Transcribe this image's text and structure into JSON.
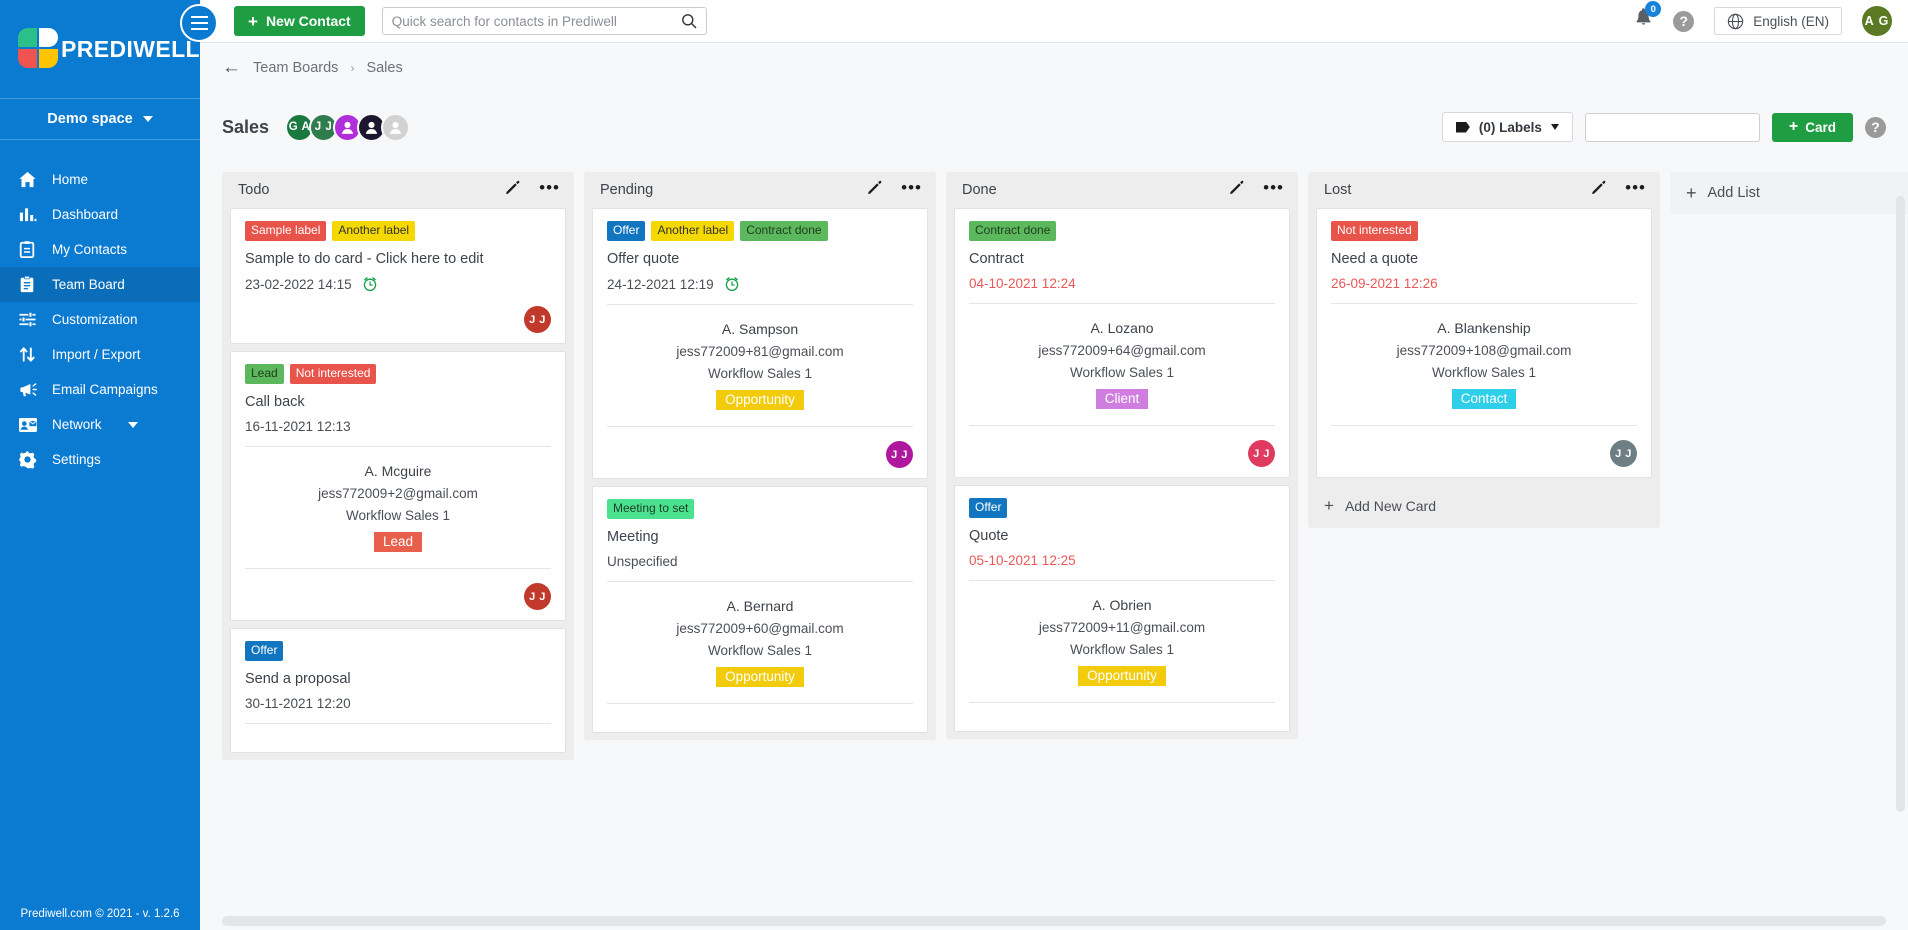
{
  "brand": {
    "name": "PREDIWELL",
    "space": "Demo space"
  },
  "topbar": {
    "new_contact_label": "New Contact",
    "search_placeholder": "Quick search for contacts in Prediwell",
    "search_value": "",
    "notifications_count": "0",
    "language": "English (EN)",
    "user_initials": "A G",
    "help_label": "?"
  },
  "sidebar": {
    "items": [
      {
        "label": "Home",
        "icon": "home-icon",
        "active": false
      },
      {
        "label": "Dashboard",
        "icon": "chart-icon",
        "active": false
      },
      {
        "label": "My Contacts",
        "icon": "contacts-icon",
        "active": false
      },
      {
        "label": "Team Board",
        "icon": "board-icon",
        "active": true
      },
      {
        "label": "Customization",
        "icon": "sliders-icon",
        "active": false
      },
      {
        "label": "Import / Export",
        "icon": "arrows-icon",
        "active": false
      },
      {
        "label": "Email Campaigns",
        "icon": "megaphone-icon",
        "active": false
      },
      {
        "label": "Network",
        "icon": "network-icon",
        "active": false,
        "caret": true
      },
      {
        "label": "Settings",
        "icon": "gear-icon",
        "active": false
      }
    ],
    "footer": "Prediwell.com © 2021 - v. 1.2.6"
  },
  "breadcrumb": {
    "back": "←",
    "parent": "Team Boards",
    "sep": "›",
    "current": "Sales"
  },
  "board": {
    "title": "Sales",
    "members": [
      {
        "initials": "G A",
        "color": "#19793f",
        "type": "initials"
      },
      {
        "initials": "J J",
        "color": "#2f7d4c",
        "type": "initials"
      },
      {
        "initials": "",
        "color": "#b12fdb",
        "type": "person"
      },
      {
        "initials": "",
        "color": "#1c1630",
        "type": "person"
      },
      {
        "initials": "",
        "color": "#d2d2d2",
        "type": "person"
      }
    ],
    "labels_button": "(0) Labels",
    "search_value": "",
    "search_placeholder": "",
    "add_card_label": "Card",
    "add_list_label": "Add List",
    "add_new_card_label": "Add New Card"
  },
  "colors": {
    "brand_blue": "#0b7ad1",
    "green": "#1f9d42",
    "overdue_red": "#eb5757",
    "chip_red": "#e8534a",
    "chip_yellow": "#f5d800",
    "chip_green_dark": "#5cb85c",
    "chip_green_light": "#4ae28e",
    "chip_blue": "#1175bf",
    "stage_lead": "#e8604c",
    "stage_opportunity": "#f2cc0c",
    "stage_client": "#cf7ee0",
    "stage_contact": "#2ecfe8"
  },
  "lists": [
    {
      "title": "Todo",
      "cards": [
        {
          "chips": [
            {
              "text": "Sample label",
              "bg": "#e8534a",
              "fg": "#ffffff"
            },
            {
              "text": "Another label",
              "bg": "#f5d800",
              "fg": "#333333"
            }
          ],
          "title": "Sample to do card - Click here to edit",
          "date": "23-02-2022 14:15",
          "overdue": false,
          "alarm": true,
          "contact": null,
          "avatar": {
            "initials": "J J",
            "color": "#c0392b"
          },
          "has_footer": true,
          "has_sep": false
        },
        {
          "chips": [
            {
              "text": "Lead",
              "bg": "#5cb85c",
              "fg": "#1f3d1f"
            },
            {
              "text": "Not interested",
              "bg": "#e8534a",
              "fg": "#ffffff"
            }
          ],
          "title": "Call back",
          "date": "16-11-2021 12:13",
          "overdue": false,
          "alarm": false,
          "contact": {
            "name": "A. Mcguire",
            "email": "jess772009+2@gmail.com",
            "workflow": "Workflow Sales 1",
            "stage": "Lead",
            "stage_bg": "#e8604c",
            "stage_fg": "#ffffff"
          },
          "avatar": {
            "initials": "J J",
            "color": "#c0392b"
          },
          "has_footer": true,
          "has_sep": true
        },
        {
          "chips": [
            {
              "text": "Offer",
              "bg": "#1175bf",
              "fg": "#ffffff"
            }
          ],
          "title": "Send a proposal",
          "date": "30-11-2021 12:20",
          "overdue": false,
          "alarm": false,
          "contact": null,
          "avatar": null,
          "has_footer": false,
          "has_sep": true
        }
      ],
      "show_add_card": false
    },
    {
      "title": "Pending",
      "cards": [
        {
          "chips": [
            {
              "text": "Offer",
              "bg": "#1175bf",
              "fg": "#ffffff"
            },
            {
              "text": "Another label",
              "bg": "#f5d800",
              "fg": "#333333"
            },
            {
              "text": "Contract done",
              "bg": "#5cb85c",
              "fg": "#1f3d1f"
            }
          ],
          "title": "Offer quote",
          "date": "24-12-2021 12:19",
          "overdue": false,
          "alarm": true,
          "contact": {
            "name": "A. Sampson",
            "email": "jess772009+81@gmail.com",
            "workflow": "Workflow Sales 1",
            "stage": "Opportunity",
            "stage_bg": "#f2cc0c",
            "stage_fg": "#ffffff"
          },
          "avatar": {
            "initials": "J J",
            "color": "#b0179f"
          },
          "has_footer": true,
          "has_sep": true
        },
        {
          "chips": [
            {
              "text": "Meeting to set",
              "bg": "#4ae28e",
              "fg": "#1f3d2a"
            }
          ],
          "title": "Meeting",
          "date": "Unspecified",
          "overdue": false,
          "alarm": false,
          "contact": {
            "name": "A. Bernard",
            "email": "jess772009+60@gmail.com",
            "workflow": "Workflow Sales 1",
            "stage": "Opportunity",
            "stage_bg": "#f2cc0c",
            "stage_fg": "#ffffff"
          },
          "avatar": null,
          "has_footer": false,
          "has_sep": true
        }
      ],
      "show_add_card": false
    },
    {
      "title": "Done",
      "cards": [
        {
          "chips": [
            {
              "text": "Contract done",
              "bg": "#5cb85c",
              "fg": "#1f3d1f"
            }
          ],
          "title": "Contract",
          "date": "04-10-2021 12:24",
          "overdue": true,
          "alarm": false,
          "contact": {
            "name": "A. Lozano",
            "email": "jess772009+64@gmail.com",
            "workflow": "Workflow Sales 1",
            "stage": "Client",
            "stage_bg": "#cf7ee0",
            "stage_fg": "#ffffff"
          },
          "avatar": {
            "initials": "J J",
            "color": "#e03a5f"
          },
          "has_footer": true,
          "has_sep": true
        },
        {
          "chips": [
            {
              "text": "Offer",
              "bg": "#1175bf",
              "fg": "#ffffff"
            }
          ],
          "title": "Quote",
          "date": "05-10-2021 12:25",
          "overdue": true,
          "alarm": false,
          "contact": {
            "name": "A. Obrien",
            "email": "jess772009+11@gmail.com",
            "workflow": "Workflow Sales 1",
            "stage": "Opportunity",
            "stage_bg": "#f2cc0c",
            "stage_fg": "#ffffff"
          },
          "avatar": null,
          "has_footer": false,
          "has_sep": true
        }
      ],
      "show_add_card": false
    },
    {
      "title": "Lost",
      "cards": [
        {
          "chips": [
            {
              "text": "Not interested",
              "bg": "#e8534a",
              "fg": "#ffffff"
            }
          ],
          "title": "Need a quote",
          "date": "26-09-2021 12:26",
          "overdue": true,
          "alarm": false,
          "contact": {
            "name": "A. Blankenship",
            "email": "jess772009+108@gmail.com",
            "workflow": "Workflow Sales 1",
            "stage": "Contact",
            "stage_bg": "#2ecfe8",
            "stage_fg": "#ffffff"
          },
          "avatar": {
            "initials": "J J",
            "color": "#6d7f84"
          },
          "has_footer": true,
          "has_sep": true
        }
      ],
      "show_add_card": true
    }
  ]
}
